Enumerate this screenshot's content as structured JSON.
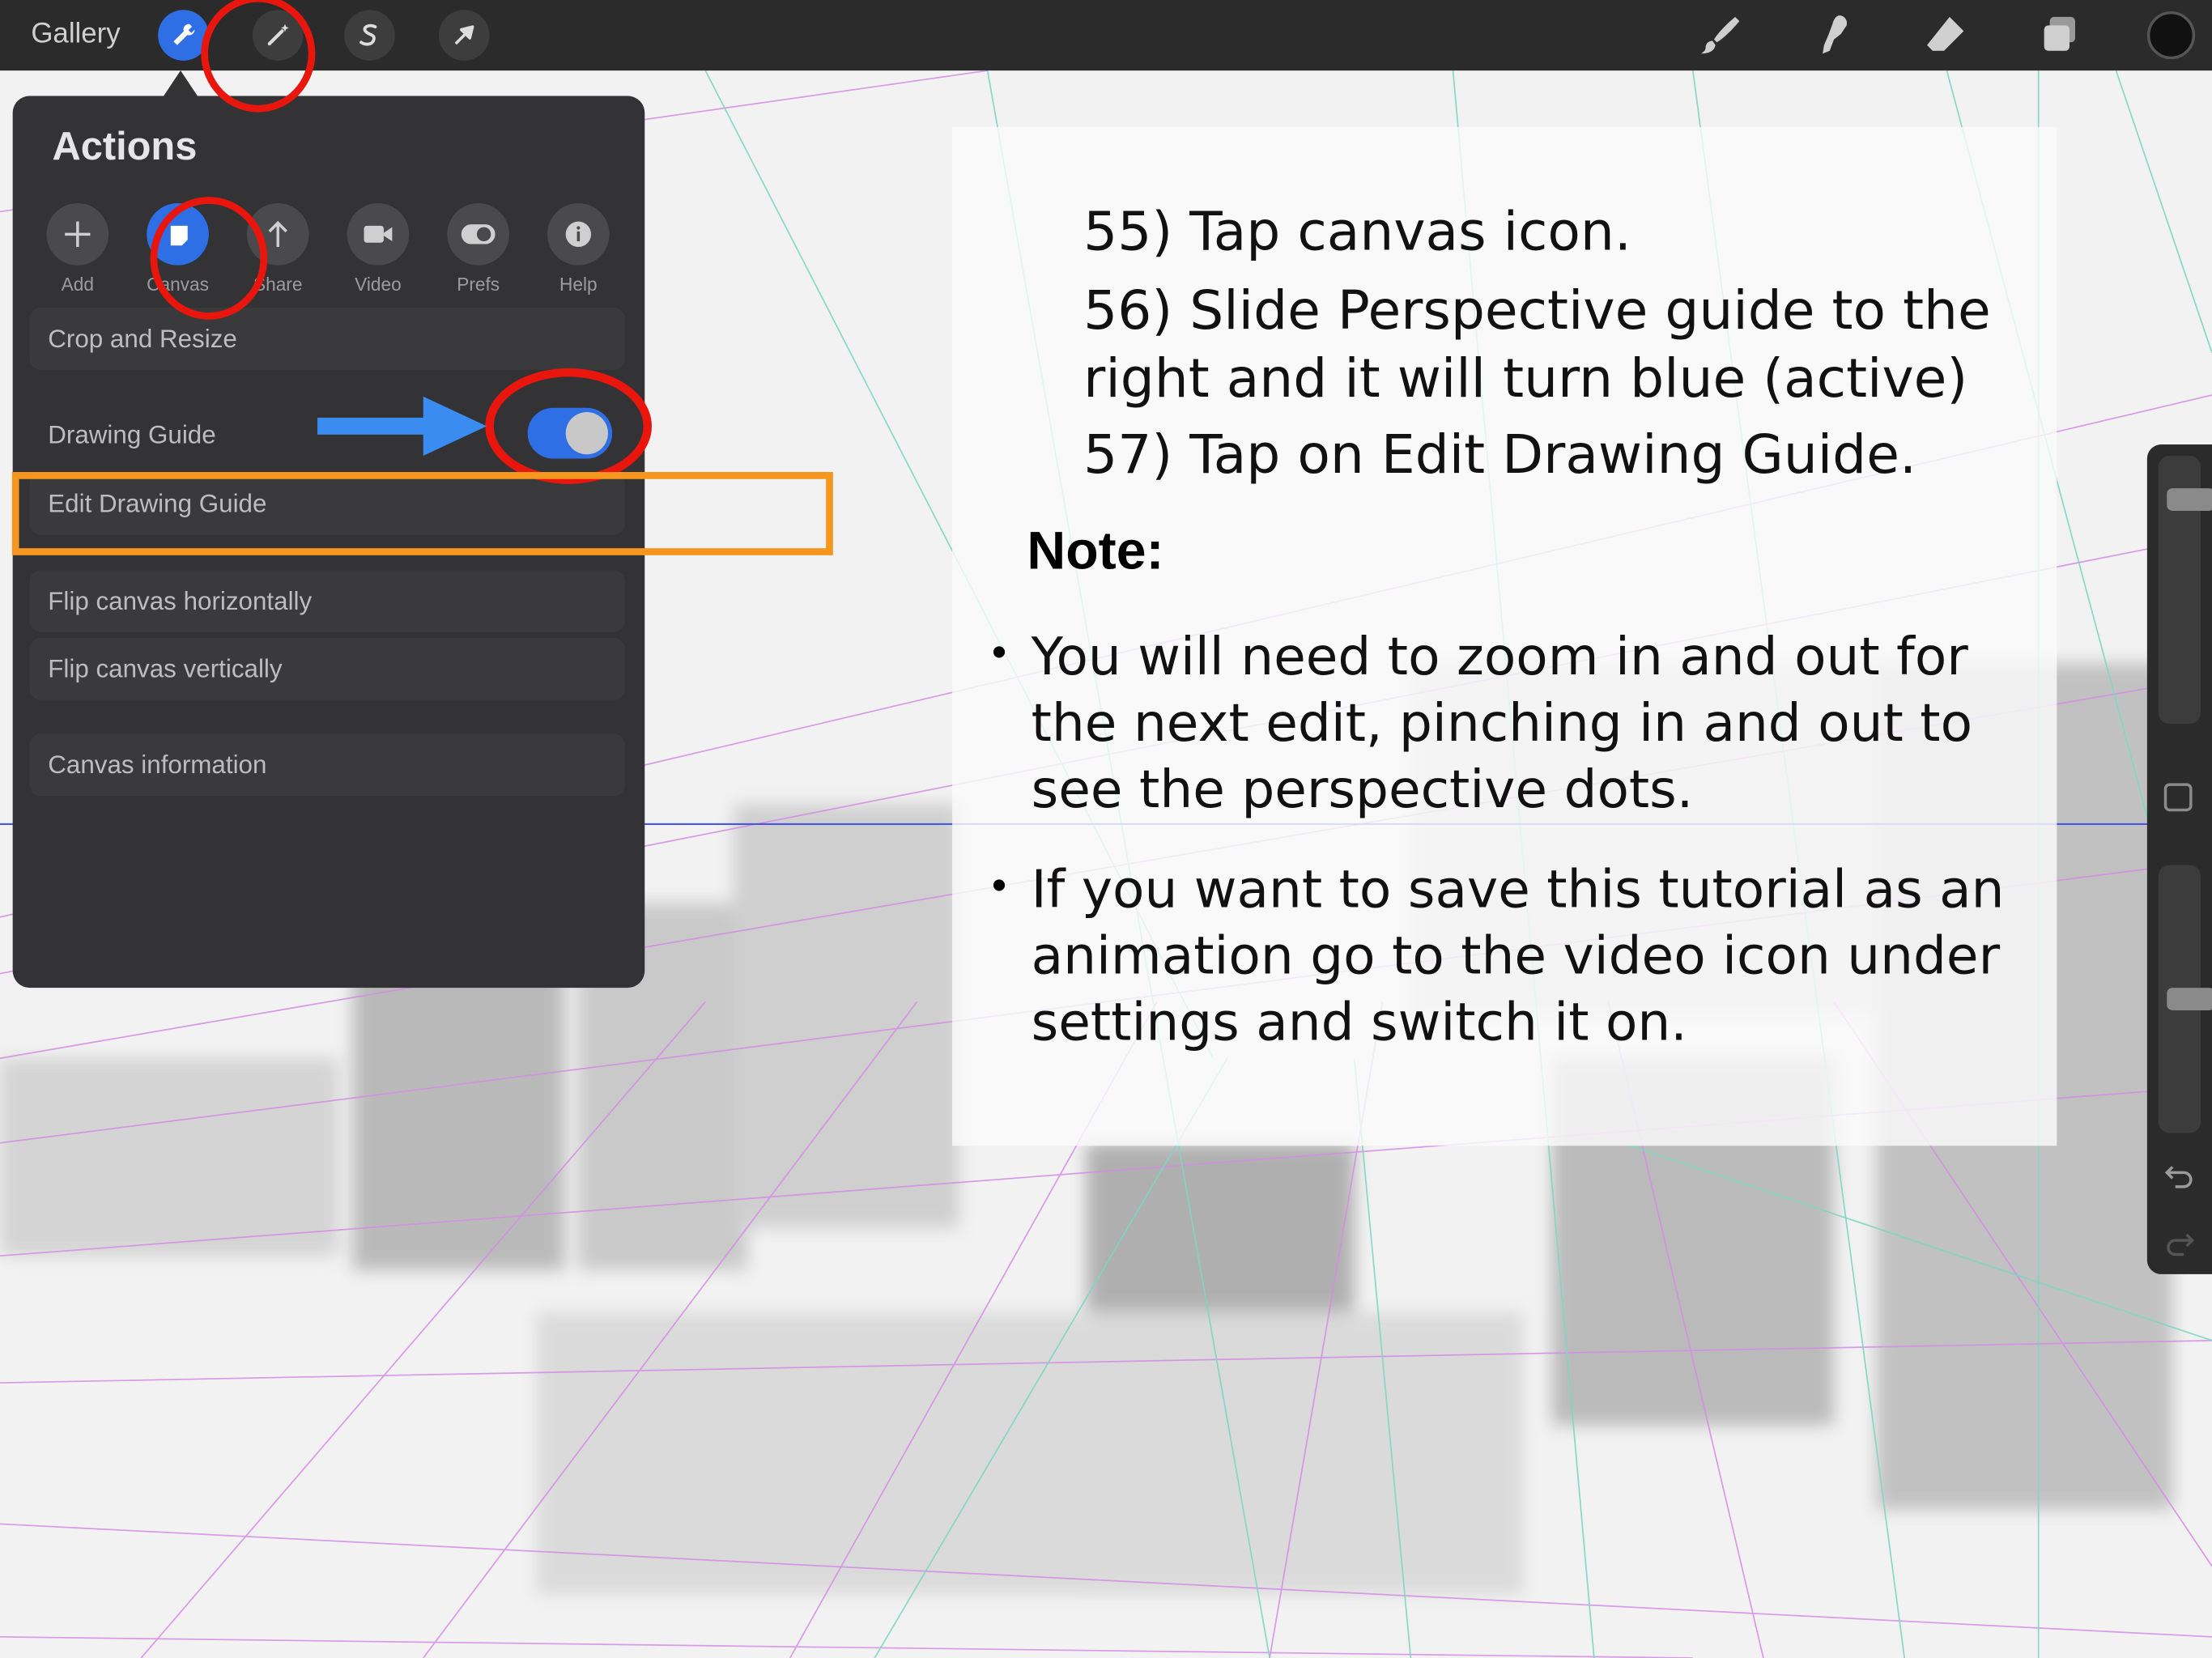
{
  "topbar": {
    "gallery_label": "Gallery",
    "left_icons": [
      "wrench-icon",
      "magic-wand-icon",
      "selection-icon",
      "transform-arrow-icon"
    ],
    "right_icons": [
      "brush-icon",
      "smudge-icon",
      "eraser-icon",
      "layers-icon",
      "color-swatch"
    ],
    "current_color": "#111111",
    "active_button_color": "#2f6fe6"
  },
  "actions": {
    "title": "Actions",
    "tabs": [
      {
        "label": "Add",
        "icon": "plus-icon"
      },
      {
        "label": "Canvas",
        "icon": "canvas-icon"
      },
      {
        "label": "Share",
        "icon": "share-arrow-icon"
      },
      {
        "label": "Video",
        "icon": "video-camera-icon"
      },
      {
        "label": "Prefs",
        "icon": "toggle-icon"
      },
      {
        "label": "Help",
        "icon": "info-icon"
      }
    ],
    "active_tab": "Canvas",
    "rows": {
      "crop": "Crop and Resize",
      "drawing_guide": "Drawing Guide",
      "edit_drawing_guide": "Edit Drawing Guide",
      "flip_h": "Flip canvas horizontally",
      "flip_v": "Flip canvas vertically",
      "canvas_info": "Canvas information"
    },
    "drawing_guide_on": true
  },
  "tutorial": {
    "step55": "55) Tap canvas icon.",
    "step56": "56) Slide Perspective guide to the right and it will turn blue (active)",
    "step57": "57) Tap on Edit Drawing Guide.",
    "note_title": "Note:",
    "bullet1": "You will need to zoom in and out for the next edit, pinching in and out to see the perspective dots.",
    "bullet2": "If you want to save this tutorial as an animation go to the video icon under settings and switch it on."
  },
  "sidebar": {
    "icons": [
      "brush-size-slider",
      "modify-button-icon",
      "opacity-slider",
      "undo-icon",
      "redo-icon"
    ],
    "brush_size_level": 0.1,
    "opacity_level": 0.5
  },
  "annotation_colors": {
    "circle": "#e8160c",
    "highlight_box": "#f5961f",
    "arrow": "#3b8cf0"
  }
}
